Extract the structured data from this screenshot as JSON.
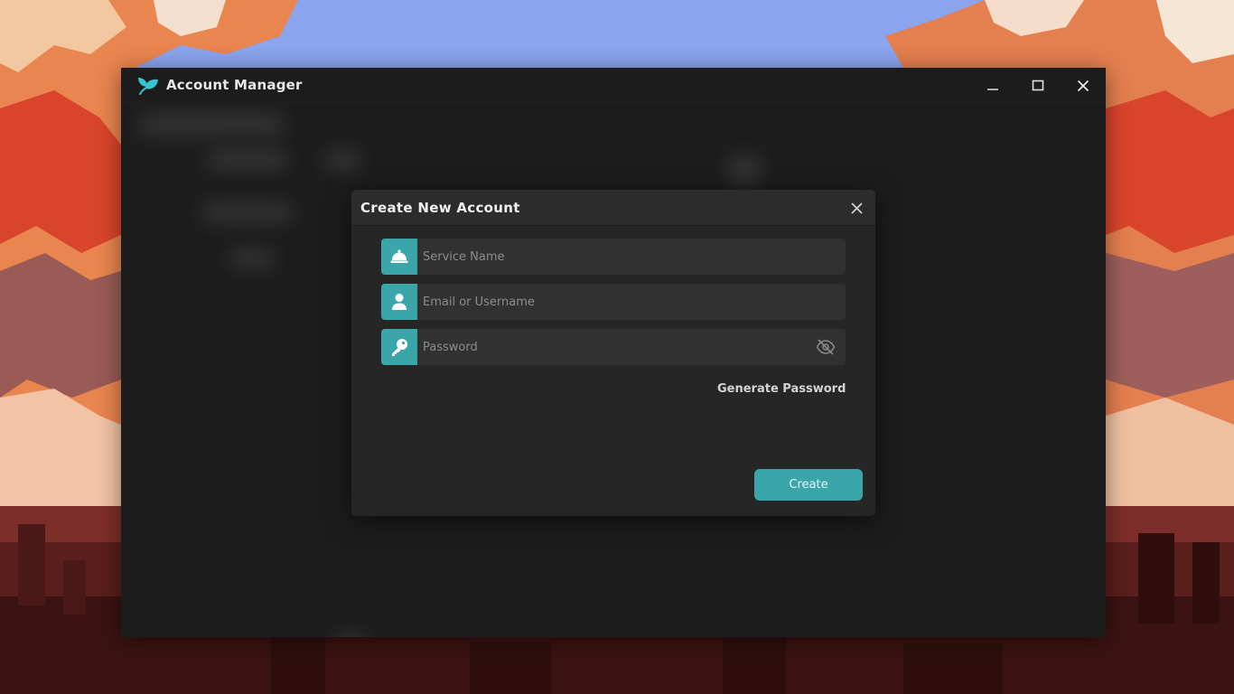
{
  "app": {
    "title": "Account Manager",
    "accent_color": "#3aa6aa",
    "window_controls": [
      "minimize-icon",
      "maximize-icon",
      "close-icon"
    ]
  },
  "dialog": {
    "title": "Create New Account",
    "close_icon": "close-icon",
    "fields": {
      "service": {
        "placeholder": "Service Name",
        "value": "",
        "icon": "service-bell-icon"
      },
      "email": {
        "placeholder": "Email or Username",
        "value": "",
        "icon": "user-icon"
      },
      "password": {
        "placeholder": "Password",
        "value": "",
        "icon": "key-icon",
        "toggle_icon": "eye-slash-icon"
      }
    },
    "generate_password_label": "Generate Password",
    "create_label": "Create"
  }
}
